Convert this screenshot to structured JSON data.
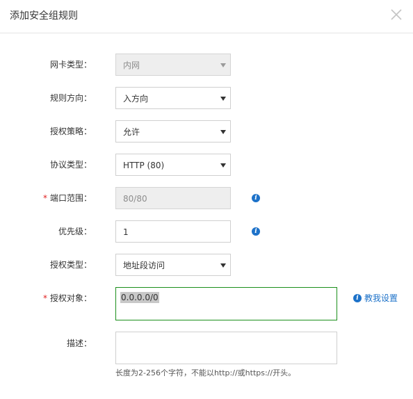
{
  "dialog": {
    "title": "添加安全组规则",
    "close_icon": "close-icon"
  },
  "form": {
    "nic_type": {
      "label": "网卡类型：",
      "value": "内网",
      "disabled": true
    },
    "direction": {
      "label": "规则方向：",
      "value": "入方向"
    },
    "policy": {
      "label": "授权策略：",
      "value": "允许"
    },
    "protocol": {
      "label": "协议类型：",
      "value": "HTTP (80)"
    },
    "port_range": {
      "required_mark": "*",
      "label": "端口范围：",
      "value": "80/80",
      "disabled": true,
      "icon": "info-icon"
    },
    "priority": {
      "label": "优先级：",
      "value": "1",
      "icon": "info-icon"
    },
    "auth_type": {
      "label": "授权类型：",
      "value": "地址段访问"
    },
    "auth_object": {
      "required_mark": "*",
      "label": "授权对象：",
      "value": "0.0.0.0/0",
      "help_link": "教我设置",
      "icon": "info-icon"
    },
    "description": {
      "label": "描述：",
      "value": "",
      "hint": "长度为2-256个字符，不能以http://或https://开头。"
    }
  },
  "colors": {
    "accent": "#1d72c9",
    "required": "#e02020",
    "focus_border": "#1a8f1a",
    "disabled_bg": "#eeeeee"
  }
}
